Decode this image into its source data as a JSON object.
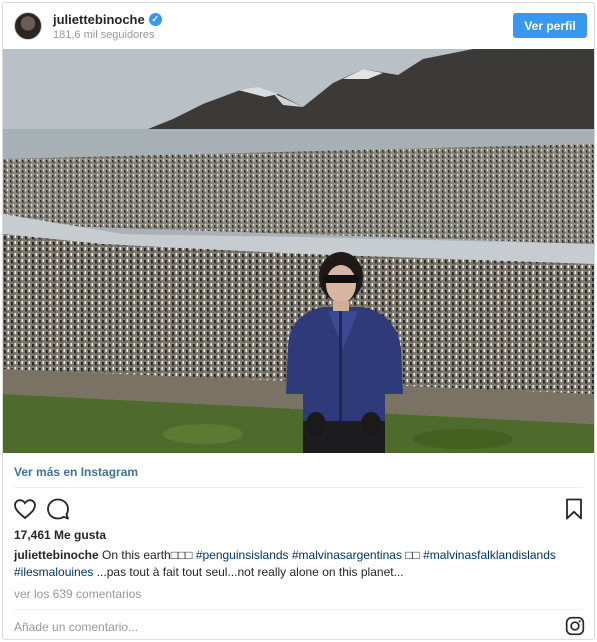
{
  "header": {
    "username": "juliettebinoche",
    "verified_mark": "✓",
    "followers": "181,6 mil seguidores",
    "follow_button": "Ver perfil",
    "accent_color": "#3897f0"
  },
  "post": {
    "image_alt": "Woman in a blue jacket and sunglasses standing in front of a huge penguin colony with mountains behind",
    "more_link": "Ver más en Instagram",
    "likes": "17,461 Me gusta",
    "caption": {
      "user": "juliettebinoche",
      "text_1": " On this earth□□□  ",
      "tags_1": "#penguinsislands #malvinasargentinas",
      "text_2": " □□ ",
      "tags_2": "#malvinasfalklandislands",
      "tags_3": "#ilesmalouines",
      "text_3": " ...pas tout à fait tout seul...not really alone on this planet..."
    },
    "comments_link": "ver los 639 comentarios",
    "comment_placeholder": "Añade un comentario..."
  },
  "icons": {
    "like": "heart-icon",
    "comment": "comment-icon",
    "save": "bookmark-icon",
    "brand": "instagram-icon"
  }
}
